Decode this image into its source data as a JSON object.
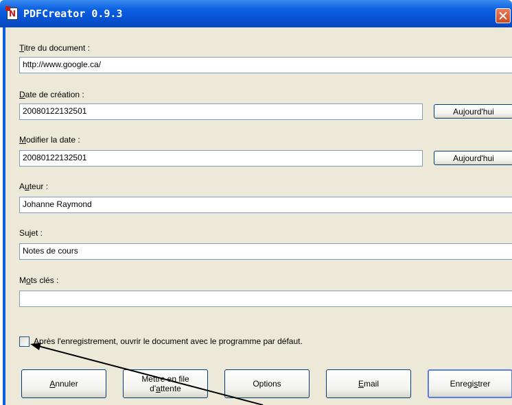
{
  "window": {
    "title": "PDFCreator 0.9.3",
    "app_icon_glyph": "N"
  },
  "fields": {
    "title": {
      "label_acc": "T",
      "label_rest": "itre du document :",
      "value": "http://www.google.ca/"
    },
    "creation_date": {
      "label_acc": "D",
      "label_rest": "ate de création :",
      "value": "20080122132501",
      "today_label": "Aujourd'hui"
    },
    "modify_date": {
      "label_acc": "M",
      "label_rest": "odifier la date :",
      "value": "20080122132501",
      "today_label": "Aujourd'hui"
    },
    "author": {
      "label_pre": "A",
      "label_acc": "u",
      "label_rest": "teur :",
      "value": "Johanne Raymond"
    },
    "subject": {
      "label": "Sujet :",
      "value": "Notes de cours"
    },
    "keywords": {
      "label_pre": "M",
      "label_acc": "o",
      "label_rest": "ts clés :",
      "value": ""
    }
  },
  "open_after_save": {
    "checked": false,
    "label_acc": "A",
    "label_rest": "près l'enregistrement, ouvrir le document avec le programme par défaut."
  },
  "buttons": {
    "cancel": {
      "acc": "A",
      "rest": "nnuler"
    },
    "queue": {
      "line1": "Mettre en file",
      "line2_pre": "d'",
      "line2_acc": "a",
      "line2_rest": "ttente"
    },
    "options": {
      "label": "Options"
    },
    "email": {
      "acc": "E",
      "rest": "mail"
    },
    "save": {
      "pre": "Enregi",
      "acc": "s",
      "rest": "trer"
    }
  }
}
